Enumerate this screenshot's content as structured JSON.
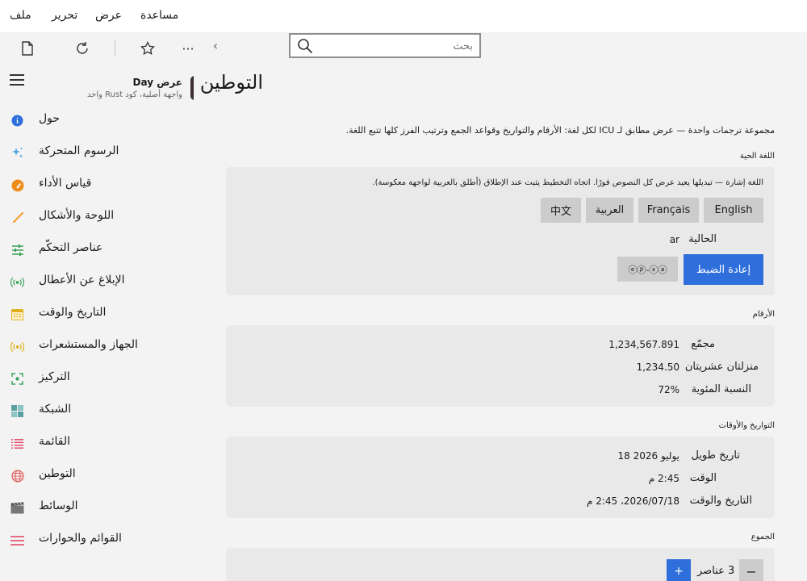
{
  "menubar": {
    "file": "ملف",
    "edit": "تحرير",
    "view": "عرض",
    "help": "مساعدة"
  },
  "toolbar": {
    "new_icon": "new-document-icon",
    "refresh_icon": "refresh-icon",
    "favorite_icon": "star-icon",
    "more_label": "···",
    "back_label": "‹"
  },
  "search": {
    "placeholder": "بحث",
    "value": ""
  },
  "sidebar": {
    "app_title": "عرض Day",
    "app_subtitle": "واجهة أصلية، كود Rust واحد",
    "items": [
      {
        "label": "حول",
        "icon": "info-icon",
        "color": "#2e6fdb"
      },
      {
        "label": "الرسوم المتحركة",
        "icon": "sparkle-icon",
        "color": "#4aa3df"
      },
      {
        "label": "قياس الأداء",
        "icon": "speedometer-icon",
        "color": "#f08c1a"
      },
      {
        "label": "اللوحة والأشكال",
        "icon": "brush-icon",
        "color": "#f0a030"
      },
      {
        "label": "عناصر التحكّم",
        "icon": "sliders-icon",
        "color": "#3aa35a"
      },
      {
        "label": "الإبلاغ عن الأعطال",
        "icon": "broadcast-icon",
        "color": "#3aa35a"
      },
      {
        "label": "التاريخ والوقت",
        "icon": "calendar-icon",
        "color": "#e0b020"
      },
      {
        "label": "الجهاز والمستشعرات",
        "icon": "sensor-icon",
        "color": "#e0b020"
      },
      {
        "label": "التركيز",
        "icon": "focus-icon",
        "color": "#3aa35a"
      },
      {
        "label": "الشبكة",
        "icon": "grid-icon",
        "color": "#5aa0a0"
      },
      {
        "label": "القائمة",
        "icon": "list-icon",
        "color": "#e04060"
      },
      {
        "label": "التوطين",
        "icon": "globe-icon",
        "color": "#e06060"
      },
      {
        "label": "الوسائط",
        "icon": "clapperboard-icon",
        "color": "#666666"
      },
      {
        "label": "القوائم والحوارات",
        "icon": "menu-icon",
        "color": "#e04060"
      }
    ]
  },
  "main": {
    "title": "التوطين",
    "intro": "مجموعة ترجمات واحدة — عرض مطابق لـ ICU لكل لغة: الأرقام والتواريخ وقواعد الجمع وترتيب الفرز كلها تتبع اللغة.",
    "live_language": {
      "section_title": "اللغة الحية",
      "note": "اللغة إشارة — تبديلها يعيد عرض كل النصوص فورًا. اتجاه التخطيط يثبت عند الإطلاق (أطلق بالعربية لواجهة معكوسة).",
      "buttons": [
        "English",
        "Français",
        "العربية",
        "中文"
      ],
      "current_label": "الحالية",
      "current_value": "ar",
      "reset_label": "إعادة الضبط",
      "pseudo_label": "ⓔⓟ-ⓧⓐ"
    },
    "numbers": {
      "section_title": "الأرقام",
      "rows": [
        {
          "label": "مجمّع",
          "value": "1,234,567.891"
        },
        {
          "label": "منزلتان عشريتان",
          "value": "1,234.50"
        },
        {
          "label": "النسبة المئوية",
          "value": "72%"
        }
      ]
    },
    "dates": {
      "section_title": "التواريخ والأوقات",
      "rows": [
        {
          "label": "تاريخ طويل",
          "value": "18 يوليو 2026"
        },
        {
          "label": "الوقت",
          "value": "2:45 م"
        },
        {
          "label": "التاريخ والوقت",
          "value": "2026/07/18، 2:45 م"
        }
      ]
    },
    "plurals": {
      "section_title": "الجموع",
      "minus_label": "−",
      "plus_label": "+",
      "count_text": "3 عناصر"
    }
  }
}
